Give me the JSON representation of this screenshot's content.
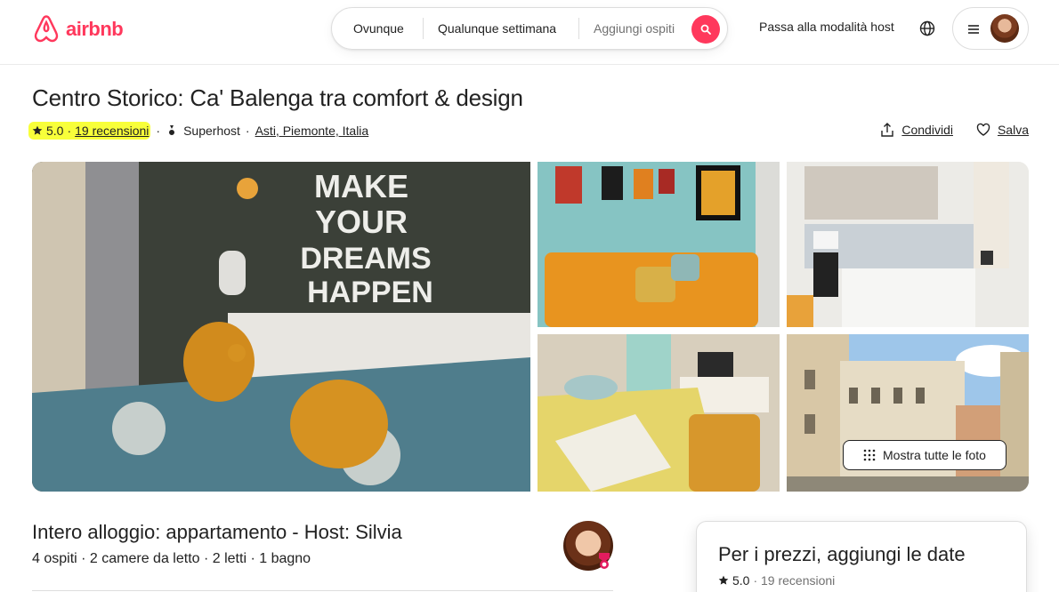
{
  "brand": {
    "name": "airbnb",
    "color": "#ff385c"
  },
  "search": {
    "where": "Ovunque",
    "when": "Qualunque settimana",
    "who": "Aggiungi ospiti"
  },
  "header": {
    "host_link": "Passa alla modalità host"
  },
  "listing": {
    "title": "Centro Storico: Ca' Balenga tra comfort & design",
    "rating": "5.0",
    "sep": "·",
    "reviews": "19 recensioni",
    "superhost": "Superhost",
    "location": "Asti, Piemonte, Italia",
    "share": "Condividi",
    "save": "Salva"
  },
  "gallery": {
    "show_all": "Mostra tutte le foto",
    "photos": [
      "main-bedroom",
      "living-room-sofa",
      "kitchen",
      "second-bedroom",
      "building-exterior"
    ],
    "wall_sign": [
      "MAKE",
      "YOUR",
      "DREAMS",
      "HAPPEN"
    ]
  },
  "details": {
    "heading": "Intero alloggio: appartamento - Host: Silvia",
    "summary": "4 ospiti · 2 camere da letto · 2 letti · 1 bagno"
  },
  "price_card": {
    "title": "Per i prezzi, aggiungi le date",
    "rating": "5.0",
    "reviews": "· 19 recensioni"
  },
  "highlight_color": "#f8ff3a"
}
